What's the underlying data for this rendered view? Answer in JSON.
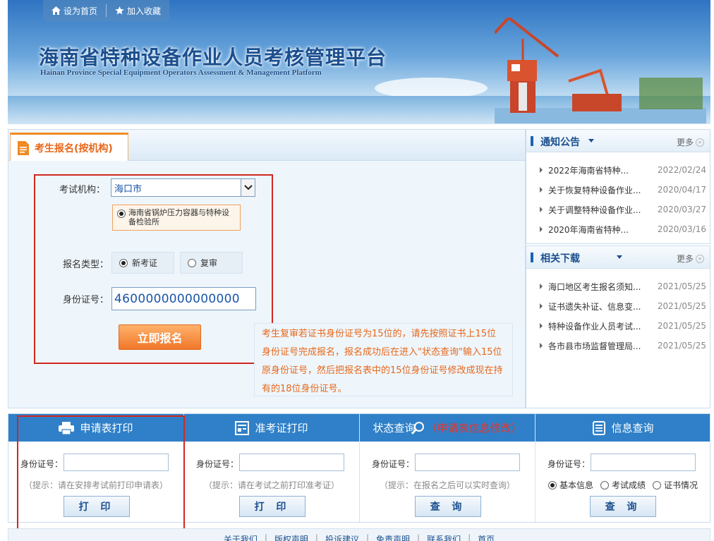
{
  "header": {
    "set_home": "设为首页",
    "add_favorite": "加入收藏",
    "title": "海南省特种设备作业人员考核管理平台",
    "subtitle": "Hainan Province Special Equipment Operators Assessment & Management Platform"
  },
  "main": {
    "tab_label": "考生报名(按机构)",
    "org_label": "考试机构：",
    "org_value": "海口市",
    "org_option": "海南省锅炉压力容器与特种设备检验所",
    "type_label": "报名类型：",
    "type_new": "新考证",
    "type_review": "复审",
    "id_label": "身份证号：",
    "id_value": "4600000000000000",
    "submit": "立即报名",
    "note": "考生复审若证书身份证号为15位的，请先按照证书上15位身份证号完成报名，报名成功后在进入\"状态查询\"输入15位原身份证号，然后把报名表中的15位身份证号修改成现在持有的18位身份证号。"
  },
  "notices": {
    "title": "通知公告",
    "more": "更多",
    "items": [
      {
        "title": "2022年海南省特种...",
        "date": "2022/02/24"
      },
      {
        "title": "关于恢复特种设备作业...",
        "date": "2020/04/17"
      },
      {
        "title": "关于调整特种设备作业...",
        "date": "2020/03/27"
      },
      {
        "title": "2020年海南省特种...",
        "date": "2020/03/16"
      }
    ]
  },
  "downloads": {
    "title": "相关下载",
    "more": "更多",
    "items": [
      {
        "title": "海口地区考生报名须知...",
        "date": "2021/05/25"
      },
      {
        "title": "证书遗失补证、信息变...",
        "date": "2021/05/25"
      },
      {
        "title": "特种设备作业人员考试...",
        "date": "2021/05/25"
      },
      {
        "title": "各市县市场监督管理局...",
        "date": "2021/05/25"
      }
    ]
  },
  "panels": {
    "print_app": {
      "title": "申请表打印",
      "label": "身份证号：",
      "tip": "（提示：请在安排考试前打印申请表）",
      "button": "打 印"
    },
    "print_ticket": {
      "title": "准考证打印",
      "label": "身份证号：",
      "tip": "（提示：请在考试之前打印准考证）",
      "button": "打 印"
    },
    "status": {
      "title": "状态查询",
      "title_extra": "（申请表信息修改）",
      "label": "身份证号：",
      "tip": "（提示：在报名之后可以实时查询）",
      "button": "查 询"
    },
    "info": {
      "title": "信息查询",
      "label": "身份证号：",
      "opt1": "基本信息",
      "opt2": "考试成绩",
      "opt3": "证书情况",
      "button": "查 询"
    }
  },
  "footer": {
    "links": [
      "关于我们",
      "版权声明",
      "投诉建议",
      "免责声明",
      "联系我们",
      "首页"
    ]
  },
  "colors": {
    "accent": "#f08a24",
    "brand_blue": "#2f80c8",
    "highlight_red": "#d0281f"
  }
}
